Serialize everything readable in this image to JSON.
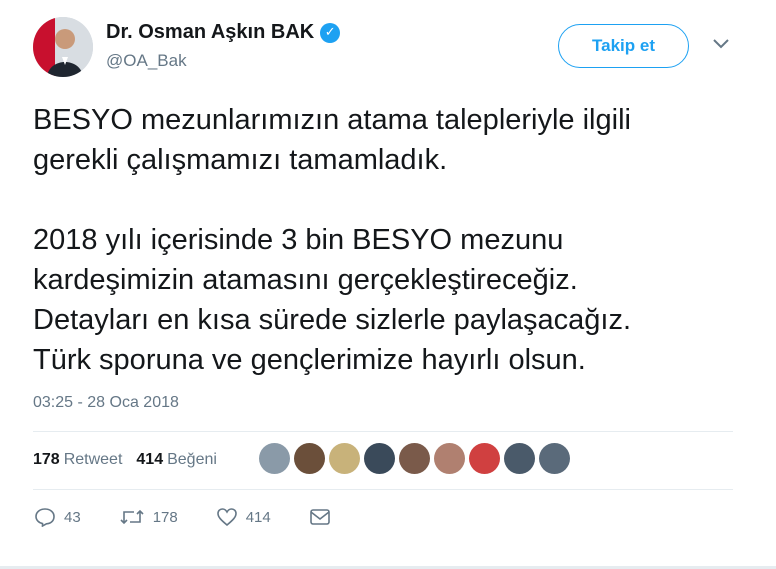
{
  "header": {
    "display_name": "Dr. Osman Aşkın BAK",
    "handle": "@OA_Bak",
    "verified_icon": "checkmark-badge-icon",
    "follow_label": "Takip et",
    "menu_icon": "chevron-down-icon"
  },
  "tweet": {
    "text": "BESYO mezunlarımızın atama talepleriyle ilgili\ngerekli çalışmamızı tamamladık.\n\n2018 yılı içerisinde 3 bin BESYO mezunu\nkardeşimizin atamasını gerçekleştireceğiz.\nDetayları en kısa sürede sizlerle paylaşacağız.\nTürk sporuna ve gençlerimize hayırlı olsun.",
    "timestamp": "03:25 - 28 Oca 2018"
  },
  "stats": {
    "retweet_count": "178",
    "retweet_label": "Retweet",
    "like_count": "414",
    "like_label": "Beğeni"
  },
  "liker_avatars": [
    "#8a9aa8",
    "#6b4f3a",
    "#c8b27a",
    "#3a4a5a",
    "#7a5a4a",
    "#b08070",
    "#d04040",
    "#4a5a6a",
    "#5a6a7a"
  ],
  "actions": {
    "reply_count": "43",
    "retweet_count": "178",
    "like_count": "414"
  },
  "colors": {
    "accent": "#1da1f2",
    "muted": "#657786"
  }
}
